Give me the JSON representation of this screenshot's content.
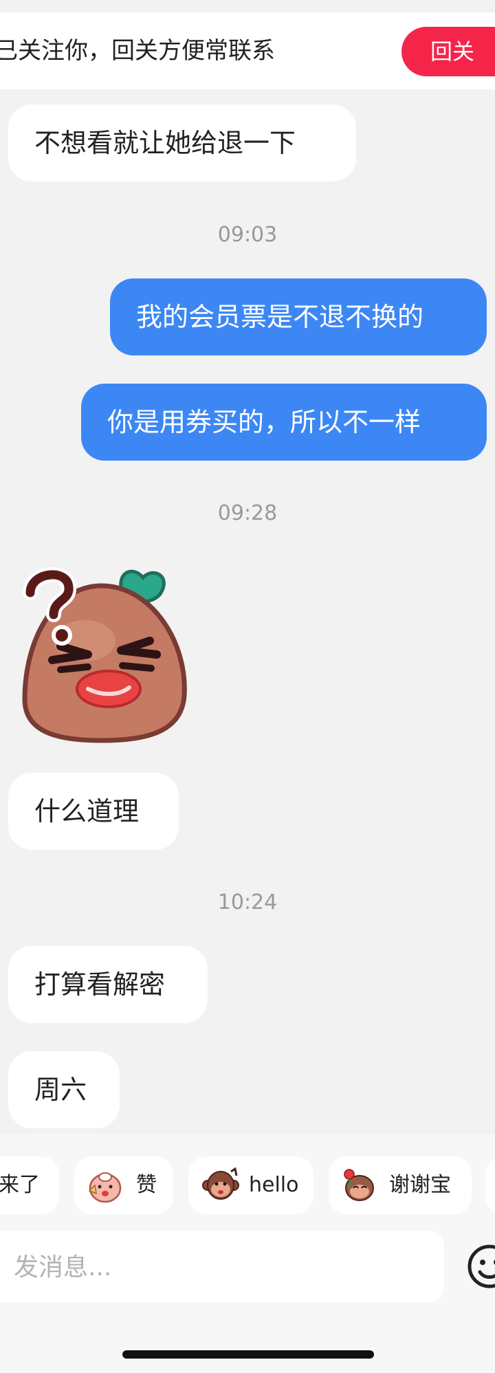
{
  "follow_banner": {
    "text": "已关注你，回关方便常联系",
    "button_label": "回关"
  },
  "messages": [
    {
      "id": "m1",
      "direction": "incoming",
      "text": "不想看就让她给退一下"
    },
    {
      "id": "t1",
      "type": "timestamp",
      "text": "09:03"
    },
    {
      "id": "m2",
      "direction": "outgoing",
      "text": "我的会员票是不退不换的"
    },
    {
      "id": "m3",
      "direction": "outgoing",
      "text": "你是用券买的，所以不一样"
    },
    {
      "id": "t2",
      "type": "timestamp",
      "text": "09:28"
    },
    {
      "id": "s1",
      "direction": "incoming",
      "type": "sticker",
      "icon": "confused-potato-sticker"
    },
    {
      "id": "m4",
      "direction": "incoming",
      "text": "什么道理"
    },
    {
      "id": "t3",
      "type": "timestamp",
      "text": "10:24"
    },
    {
      "id": "m5",
      "direction": "incoming",
      "text": "打算看解密"
    },
    {
      "id": "m6",
      "direction": "incoming",
      "text": "周六"
    }
  ],
  "quick_replies": [
    {
      "label": "来了",
      "icon": ""
    },
    {
      "label": "赞",
      "icon": "thumbs-up-sticker-icon"
    },
    {
      "label": "hello",
      "icon": "monkey-hello-sticker-icon"
    },
    {
      "label": "谢谢宝",
      "icon": "monkey-rose-sticker-icon"
    }
  ],
  "input": {
    "placeholder": "发消息...",
    "value": ""
  },
  "colors": {
    "background": "#f2f2f2",
    "outgoing_bubble": "#3d87f5",
    "incoming_bubble": "#ffffff",
    "follow_button": "#f5254a",
    "timestamp": "#999999"
  },
  "icons": {
    "emoji_button": "smiley-face-icon"
  }
}
